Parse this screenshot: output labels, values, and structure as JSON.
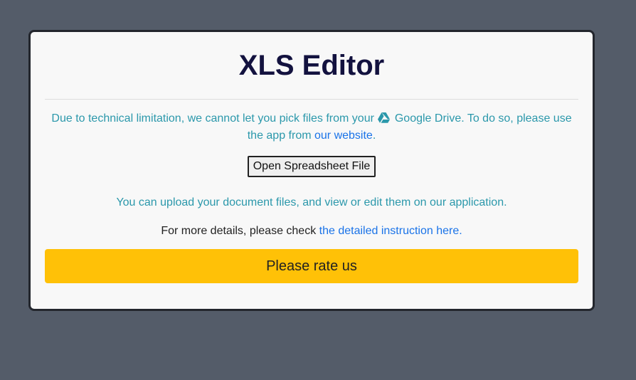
{
  "app": {
    "title": "XLS Editor"
  },
  "notice": {
    "text_before": "Due to technical limitation, we cannot let you pick files from your",
    "drive_label": "Google Drive",
    "text_middle": ". To do so, please use the app from",
    "website_link": "our website",
    "text_end": "."
  },
  "open_button": {
    "label": "Open Spreadsheet File"
  },
  "upload": {
    "text": "You can upload your document files, and view or edit them on our application."
  },
  "details": {
    "text": "For more details, please check",
    "link": "the detailed instruction here."
  },
  "rate_button": {
    "label": "Please rate us"
  },
  "icons": {
    "drive": "google-drive-icon"
  },
  "colors": {
    "background": "#545c69",
    "card": "#f8f8f8",
    "title": "#13123f",
    "notice_text": "#2b98ab",
    "link": "#1a73e8",
    "rate_button": "#ffc107"
  }
}
